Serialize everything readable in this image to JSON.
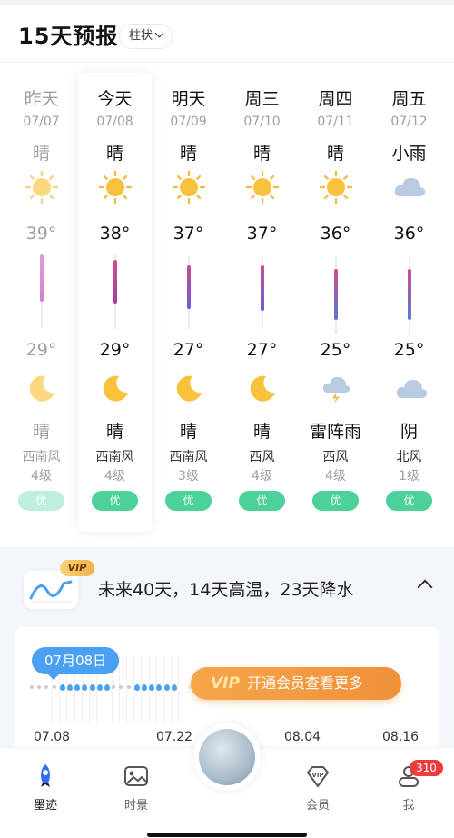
{
  "header": {
    "title": "15天预报",
    "mode_label": "柱状"
  },
  "days": [
    {
      "day": "昨天",
      "date": "07/07",
      "cond": "晴",
      "icon": "sun-icon",
      "hi": "39°",
      "lo": "29°",
      "night_icon": "moon-icon",
      "night_cond": "晴",
      "wind": "西南风",
      "level": "4级",
      "aqi": "优",
      "past": true
    },
    {
      "day": "今天",
      "date": "07/08",
      "cond": "晴",
      "icon": "sun-icon",
      "hi": "38°",
      "lo": "29°",
      "night_icon": "moon-icon",
      "night_cond": "晴",
      "wind": "西南风",
      "level": "4级",
      "aqi": "优",
      "past": false
    },
    {
      "day": "明天",
      "date": "07/09",
      "cond": "晴",
      "icon": "sun-icon",
      "hi": "37°",
      "lo": "27°",
      "night_icon": "moon-icon",
      "night_cond": "晴",
      "wind": "西南风",
      "level": "3级",
      "aqi": "优",
      "past": false
    },
    {
      "day": "周三",
      "date": "07/10",
      "cond": "晴",
      "icon": "sun-icon",
      "hi": "37°",
      "lo": "27°",
      "night_icon": "moon-icon",
      "night_cond": "晴",
      "wind": "西风",
      "level": "4级",
      "aqi": "优",
      "past": false
    },
    {
      "day": "周四",
      "date": "07/11",
      "cond": "晴",
      "icon": "sun-icon",
      "hi": "36°",
      "lo": "25°",
      "night_icon": "thunderstorm-icon",
      "night_cond": "雷阵雨",
      "wind": "西风",
      "level": "4级",
      "aqi": "优",
      "past": false
    },
    {
      "day": "周五",
      "date": "07/12",
      "cond": "小雨",
      "icon": "cloud-icon",
      "hi": "36°",
      "lo": "25°",
      "night_icon": "cloud-icon",
      "night_cond": "阴",
      "wind": "北风",
      "level": "1级",
      "aqi": "优",
      "past": false
    }
  ],
  "promo": {
    "vip_badge": "VIP",
    "summary": "未来40天，14天高温，23天降水",
    "selected_date": "07月08日",
    "vip_button": "开通会员查看更多",
    "vip_mark": "VIP",
    "date_labels": [
      "07.08",
      "07.22",
      "08.04",
      "08.16"
    ]
  },
  "tabs": [
    {
      "label": "墨迹",
      "icon": "rocket-icon",
      "active": true
    },
    {
      "label": "时景",
      "icon": "image-icon",
      "active": false
    },
    {
      "label": "会员",
      "icon": "vip-diamond-icon",
      "active": false
    },
    {
      "label": "我",
      "icon": "user-icon",
      "active": false
    }
  ],
  "profile_badge": "310",
  "colors": {
    "accent_blue": "#4aa0f2",
    "aqi_green": "#4bd199",
    "vip_orange": "#f0903a",
    "badge_red": "#ef3b3b"
  }
}
